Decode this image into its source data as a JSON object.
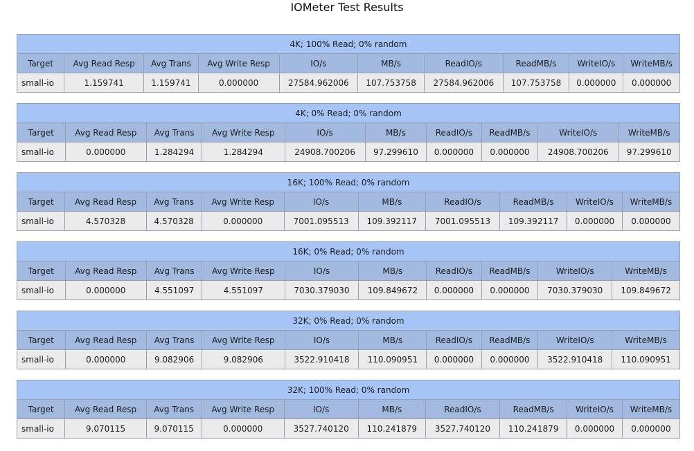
{
  "page": {
    "title": "IOMeter Test Results"
  },
  "columns": [
    "Target",
    "Avg Read Resp",
    "Avg Trans",
    "Avg Write Resp",
    "IO/s",
    "MB/s",
    "ReadIO/s",
    "ReadMB/s",
    "WriteIO/s",
    "WriteMB/s"
  ],
  "tables": [
    {
      "caption": "4K; 100% Read; 0% random",
      "row": [
        "small-io",
        "1.159741",
        "1.159741",
        "0.000000",
        "27584.962006",
        "107.753758",
        "27584.962006",
        "107.753758",
        "0.000000",
        "0.000000"
      ]
    },
    {
      "caption": "4K; 0% Read; 0% random",
      "row": [
        "small-io",
        "0.000000",
        "1.284294",
        "1.284294",
        "24908.700206",
        "97.299610",
        "0.000000",
        "0.000000",
        "24908.700206",
        "97.299610"
      ]
    },
    {
      "caption": "16K; 100% Read; 0% random",
      "row": [
        "small-io",
        "4.570328",
        "4.570328",
        "0.000000",
        "7001.095513",
        "109.392117",
        "7001.095513",
        "109.392117",
        "0.000000",
        "0.000000"
      ]
    },
    {
      "caption": "16K; 0% Read; 0% random",
      "row": [
        "small-io",
        "0.000000",
        "4.551097",
        "4.551097",
        "7030.379030",
        "109.849672",
        "0.000000",
        "0.000000",
        "7030.379030",
        "109.849672"
      ]
    },
    {
      "caption": "32K; 0% Read; 0% random",
      "row": [
        "small-io",
        "0.000000",
        "9.082906",
        "9.082906",
        "3522.910418",
        "110.090951",
        "0.000000",
        "0.000000",
        "3522.910418",
        "110.090951"
      ]
    },
    {
      "caption": "32K; 100% Read; 0% random",
      "row": [
        "small-io",
        "9.070115",
        "9.070115",
        "0.000000",
        "3527.740120",
        "110.241879",
        "3527.740120",
        "110.241879",
        "0.000000",
        "0.000000"
      ]
    }
  ],
  "colors": {
    "caption_bg": "#a6c4f5",
    "header_bg": "#a2bae0",
    "row_bg": "#ebebeb",
    "border": "#9a9fae"
  }
}
